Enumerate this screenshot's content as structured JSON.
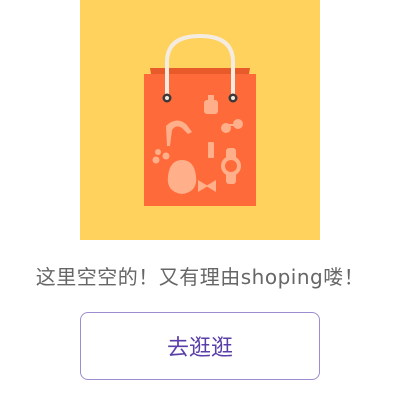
{
  "empty_state": {
    "message": "这里空空的！又有理由shoping喽！",
    "button_label": "去逛逛",
    "illustration_icon": "shopping-bag-icon"
  },
  "colors": {
    "illustration_background": "#FFD25E",
    "bag": "#FF6A3A",
    "bag_back": "#E85A2A",
    "button_text": "#5B3FA8",
    "button_border": "#9D8CD0",
    "message_text": "#666666"
  }
}
